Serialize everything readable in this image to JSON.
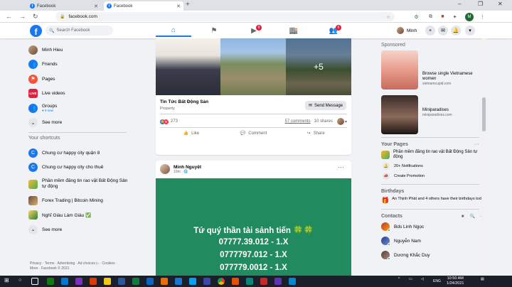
{
  "browser": {
    "tabs": [
      {
        "label": "Facebook",
        "active": false
      },
      {
        "label": "Facebook",
        "active": true
      }
    ],
    "new_tab": "+",
    "url": "facebook.com",
    "window_controls": [
      "–",
      "❐",
      "✕"
    ],
    "profile_letter": "M"
  },
  "fb_nav": {
    "logo": "f",
    "search_placeholder": "Search Facebook",
    "video_badge": "9",
    "groups_badge": "6",
    "user_name": "Minh"
  },
  "left": {
    "items": [
      {
        "label": "Minh Hieu",
        "icon": "user-avatar"
      },
      {
        "label": "Friends",
        "icon": "friends-icon"
      },
      {
        "label": "Pages",
        "icon": "flag-icon"
      },
      {
        "label": "Live videos",
        "icon": "live-icon"
      },
      {
        "label": "Groups",
        "sub": "● 9 new",
        "icon": "groups-icon"
      },
      {
        "label": "See more",
        "icon": "chevron-down-icon"
      }
    ],
    "shortcuts_title": "Your shortcuts",
    "shortcuts": [
      {
        "label": "Chung cư happy city quận 8"
      },
      {
        "label": "Chung cư happy city cho thuê"
      },
      {
        "label": "Phần mềm đăng tin rao vặt Bất Động Sản tự động"
      },
      {
        "label": "Forex Trading | Bitcoin Mining"
      },
      {
        "label": "Nghĩ Giàu Làm Giàu ✅"
      },
      {
        "label": "See more"
      }
    ],
    "footer": "Privacy · Terms · Advertising · Ad choices ▷ · Cookies · More · Facebook © 2021"
  },
  "post1": {
    "more_count": "+5",
    "title": "Tin Tức Bất Động Sản",
    "subtitle": "Property",
    "send_message": "Send Message",
    "reactions_count": "273",
    "comments": "57 comments",
    "shares": "10 shares",
    "like": "Like",
    "comment": "Comment",
    "share": "Share"
  },
  "post2": {
    "author": "Minh Nguyệt",
    "time": "10m · 🌐",
    "lines": [
      "Tứ quý thần tài sảnh tiến 🍀🍀",
      "07777.39.012 - 1.X",
      "0777797.012 - 1.X",
      "077779.0012 - 1.X"
    ]
  },
  "right": {
    "sponsored_title": "Sponsored",
    "ads": [
      {
        "title": "Browse single Vietnamese women",
        "domain": "vietnamcupid.com"
      },
      {
        "title": "Miniparadises",
        "domain": "miniparadises.com"
      }
    ],
    "pages_title": "Your Pages",
    "page_name": "Phần mềm đăng tin rao vặt Bất Động Sản tự động",
    "notifications": "20+ Notifications",
    "promotion": "Create Promotion",
    "birthdays_title": "Birthdays",
    "birthday_text": "An Thịnh Phát and 4 others have their birthdays today.",
    "contacts_title": "Contacts",
    "contacts": [
      {
        "name": "Bds Linh Ngọc"
      },
      {
        "name": "Nguyễn Nam"
      },
      {
        "name": "Dương Khắc Duy"
      }
    ]
  },
  "taskbar": {
    "lang": "ENG",
    "time": "10:50 AM",
    "date": "1/24/2021"
  },
  "colors": {
    "fb_blue": "#1877f2",
    "post_green": "#218b5f",
    "badge_red": "#e41e3f"
  }
}
